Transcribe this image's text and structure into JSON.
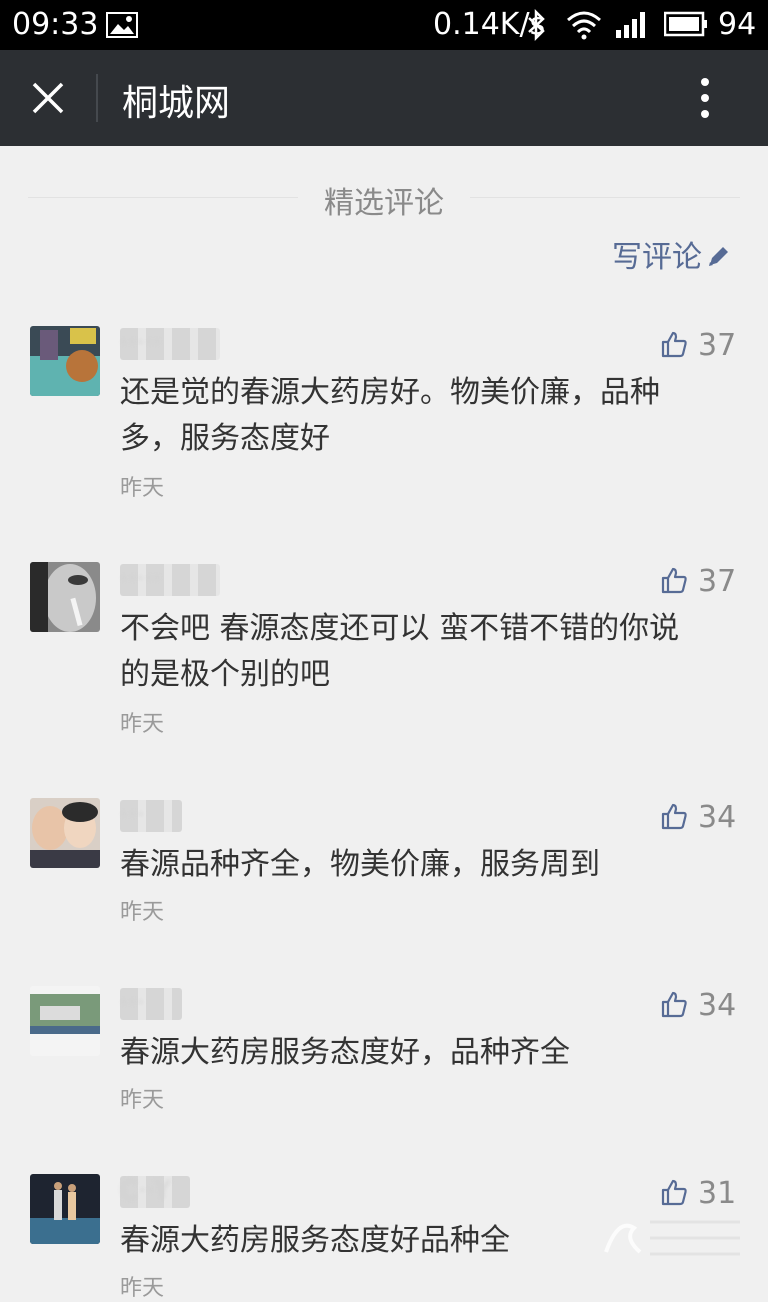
{
  "status_bar": {
    "time": "09:33",
    "network_rate": "0.14K/s",
    "battery": "94"
  },
  "title_bar": {
    "title": "桐城网"
  },
  "section": {
    "title": "精选评论",
    "write_label": "写评论"
  },
  "comments": [
    {
      "nickname": "·····",
      "likes": "37",
      "text_line1": "还是觉的春源大药房好。物美价廉，品种",
      "text_line2": "多，服务态度好",
      "time": "昨天"
    },
    {
      "nickname": "·····",
      "likes": "37",
      "text_line1": "不会吧 春源态度还可以 蛮不错不错的你说",
      "text_line2": "的是极个别的吧",
      "time": "昨天"
    },
    {
      "nickname": "···",
      "likes": "34",
      "text_line1": "春源品种齐全，物美价廉，服务周到",
      "text_line2": "",
      "time": "昨天"
    },
    {
      "nickname": "···",
      "likes": "34",
      "text_line1": "春源大药房服务态度好，品种齐全",
      "text_line2": "",
      "time": "昨天"
    },
    {
      "nickname": "C··Y",
      "likes": "31",
      "text_line1": "春源大药房服务态度好品种全",
      "text_line2": "",
      "time": "昨天"
    }
  ],
  "icons": {
    "close": "close-icon",
    "more": "more-vertical-icon",
    "pen": "pencil-icon",
    "thumb": "thumbs-up-icon"
  },
  "colors": {
    "title_bar": "#2c2f33",
    "link": "#576b95",
    "background": "#f0f0f0"
  }
}
